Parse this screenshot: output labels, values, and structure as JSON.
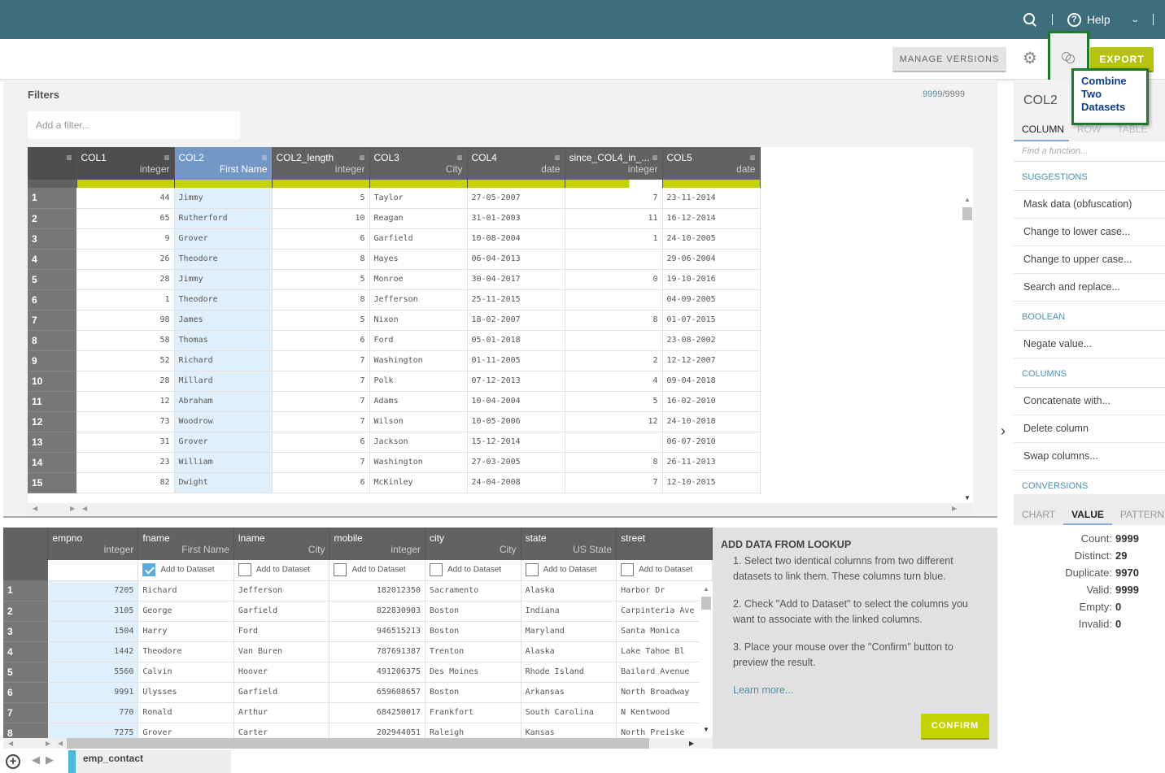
{
  "topbar": {
    "help_label": "Help"
  },
  "toolbar": {
    "manage_versions_label": "MANAGE VERSIONS",
    "export_label": "EXPORT",
    "combine_tooltip": "Combine Two Datasets"
  },
  "filters": {
    "label": "Filters",
    "placeholder": "Add a filter...",
    "count_shown": "9999",
    "count_total": "/9999"
  },
  "grid": {
    "columns": [
      {
        "name": "COL1",
        "type": "integer",
        "align": "num",
        "quality": "full",
        "header_style": "dark"
      },
      {
        "name": "COL2",
        "type": "First Name",
        "align": "text",
        "quality": "full",
        "header_style": "sel"
      },
      {
        "name": "COL2_length",
        "type": "integer",
        "align": "num",
        "quality": "full",
        "header_style": ""
      },
      {
        "name": "COL3",
        "type": "City",
        "align": "text",
        "quality": "full",
        "header_style": ""
      },
      {
        "name": "COL4",
        "type": "date",
        "align": "text",
        "quality": "full",
        "header_style": ""
      },
      {
        "name": "since_COL4_in_...",
        "type": "integer",
        "align": "num",
        "quality": "partial",
        "header_style": ""
      },
      {
        "name": "COL5",
        "type": "date",
        "align": "text",
        "quality": "full",
        "header_style": ""
      }
    ],
    "rows": [
      [
        "1",
        "44",
        "Jimmy",
        "5",
        "Taylor",
        "27-05-2007",
        "7",
        "23-11-2014"
      ],
      [
        "2",
        "65",
        "Rutherford",
        "10",
        "Reagan",
        "31-01-2003",
        "11",
        "16-12-2014"
      ],
      [
        "3",
        "9",
        "Grover",
        "6",
        "Garfield",
        "10-08-2004",
        "1",
        "24-10-2005"
      ],
      [
        "4",
        "26",
        "Theodore",
        "8",
        "Hayes",
        "06-04-2013",
        "",
        "29-06-2004"
      ],
      [
        "5",
        "28",
        "Jimmy",
        "5",
        "Monroe",
        "30-04-2017",
        "0",
        "19-10-2016"
      ],
      [
        "6",
        "1",
        "Theodore",
        "8",
        "Jefferson",
        "25-11-2015",
        "",
        "04-09-2005"
      ],
      [
        "7",
        "98",
        "James",
        "5",
        "Nixon",
        "18-02-2007",
        "8",
        "01-07-2015"
      ],
      [
        "8",
        "58",
        "Thomas",
        "6",
        "Ford",
        "05-01-2018",
        "",
        "23-08-2002"
      ],
      [
        "9",
        "52",
        "Richard",
        "7",
        "Washington",
        "01-11-2005",
        "2",
        "12-12-2007"
      ],
      [
        "10",
        "28",
        "Millard",
        "7",
        "Polk",
        "07-12-2013",
        "4",
        "09-04-2018"
      ],
      [
        "11",
        "12",
        "Abraham",
        "7",
        "Adams",
        "10-04-2004",
        "5",
        "16-02-2010"
      ],
      [
        "12",
        "73",
        "Woodrow",
        "7",
        "Wilson",
        "10-05-2006",
        "12",
        "24-10-2018"
      ],
      [
        "13",
        "31",
        "Grover",
        "6",
        "Jackson",
        "15-12-2014",
        "",
        "06-07-2010"
      ],
      [
        "14",
        "23",
        "William",
        "7",
        "Washington",
        "27-03-2005",
        "8",
        "26-11-2013"
      ],
      [
        "15",
        "82",
        "Dwight",
        "6",
        "McKinley",
        "24-04-2008",
        "7",
        "12-10-2015"
      ]
    ]
  },
  "lookup": {
    "dataset_name": "emp_contact",
    "add_to_dataset_label": "Add to Dataset",
    "columns": [
      {
        "name": "empno",
        "type": "integer",
        "align": "num",
        "checkbox": false,
        "linked": true
      },
      {
        "name": "fname",
        "type": "First Name",
        "align": "text",
        "checkbox": true,
        "checked": true
      },
      {
        "name": "lname",
        "type": "City",
        "align": "text",
        "checkbox": true,
        "checked": false
      },
      {
        "name": "mobile",
        "type": "integer",
        "align": "num",
        "checkbox": true,
        "checked": false
      },
      {
        "name": "city",
        "type": "City",
        "align": "text",
        "checkbox": true,
        "checked": false
      },
      {
        "name": "state",
        "type": "US State",
        "align": "text",
        "checkbox": true,
        "checked": false
      },
      {
        "name": "street",
        "type": "",
        "align": "text",
        "checkbox": true,
        "checked": false
      }
    ],
    "rows": [
      [
        "1",
        "7205",
        "Richard",
        "Jefferson",
        "182012350",
        "Sacramento",
        "Alaska",
        "Harbor Dr"
      ],
      [
        "2",
        "3105",
        "George",
        "Garfield",
        "822830903",
        "Boston",
        "Indiana",
        "Carpinteria Ave"
      ],
      [
        "3",
        "1504",
        "Harry",
        "Ford",
        "946515213",
        "Boston",
        "Maryland",
        "Santa Monica"
      ],
      [
        "4",
        "1442",
        "Theodore",
        "Van Buren",
        "787691387",
        "Trenton",
        "Alaska",
        "Lake Tahoe Bl"
      ],
      [
        "5",
        "5560",
        "Calvin",
        "Hoover",
        "491206375",
        "Des Moines",
        "Rhode Island",
        "Bailard Avenue"
      ],
      [
        "6",
        "9991",
        "Ulysses",
        "Garfield",
        "659608657",
        "Boston",
        "Arkansas",
        "North Broadway"
      ],
      [
        "7",
        "770",
        "Ronald",
        "Arthur",
        "684250017",
        "Frankfort",
        "South Carolina",
        "N Kentwood"
      ],
      [
        "8",
        "7275",
        "Grover",
        "Carter",
        "202944051",
        "Raleigh",
        "Kansas",
        "North Preiske"
      ]
    ],
    "help": {
      "title": "ADD DATA FROM LOOKUP",
      "step1": "1. Select two identical columns from two different datasets to link them. These columns turn blue.",
      "step2": "2. Check \"Add to Dataset\" to select the columns you want to associate with the linked columns.",
      "step3": "3. Place your mouse over the \"Confirm\" button to preview the result.",
      "learn_more": "Learn more...",
      "confirm_label": "CONFIRM"
    }
  },
  "right_panel": {
    "column_title": "COL2",
    "tabs": [
      "COLUMN",
      "ROW",
      "TABLE"
    ],
    "active_tab": "COLUMN",
    "find_placeholder": "Find a function...",
    "sections": [
      {
        "category": "SUGGESTIONS",
        "items": [
          "Mask data (obfuscation)",
          "Change to lower case...",
          "Change to upper case...",
          "Search and replace..."
        ]
      },
      {
        "category": "BOOLEAN",
        "items": [
          "Negate value..."
        ]
      },
      {
        "category": "COLUMNS",
        "items": [
          "Concatenate with...",
          "Delete column",
          "Swap columns..."
        ]
      },
      {
        "category": "CONVERSIONS",
        "items": []
      }
    ],
    "stats_tabs": [
      "CHART",
      "VALUE",
      "PATTERN"
    ],
    "active_stats_tab": "VALUE",
    "stats": [
      {
        "label": "Count:",
        "value": "9999"
      },
      {
        "label": "Distinct:",
        "value": "29"
      },
      {
        "label": "Duplicate:",
        "value": "9970"
      },
      {
        "label": "Valid:",
        "value": "9999"
      },
      {
        "label": "Empty:",
        "value": "0"
      },
      {
        "label": "Invalid:",
        "value": "0"
      }
    ]
  },
  "colors": {
    "topbar": "#3e6d7c",
    "accent_green": "#c4d200",
    "selected_column": "#7397c4",
    "selected_cell": "#dff0fc",
    "tooltip_border": "#1e7a2a",
    "tooltip_text": "#0d3e8a",
    "link_blue": "#4a8fb0"
  }
}
